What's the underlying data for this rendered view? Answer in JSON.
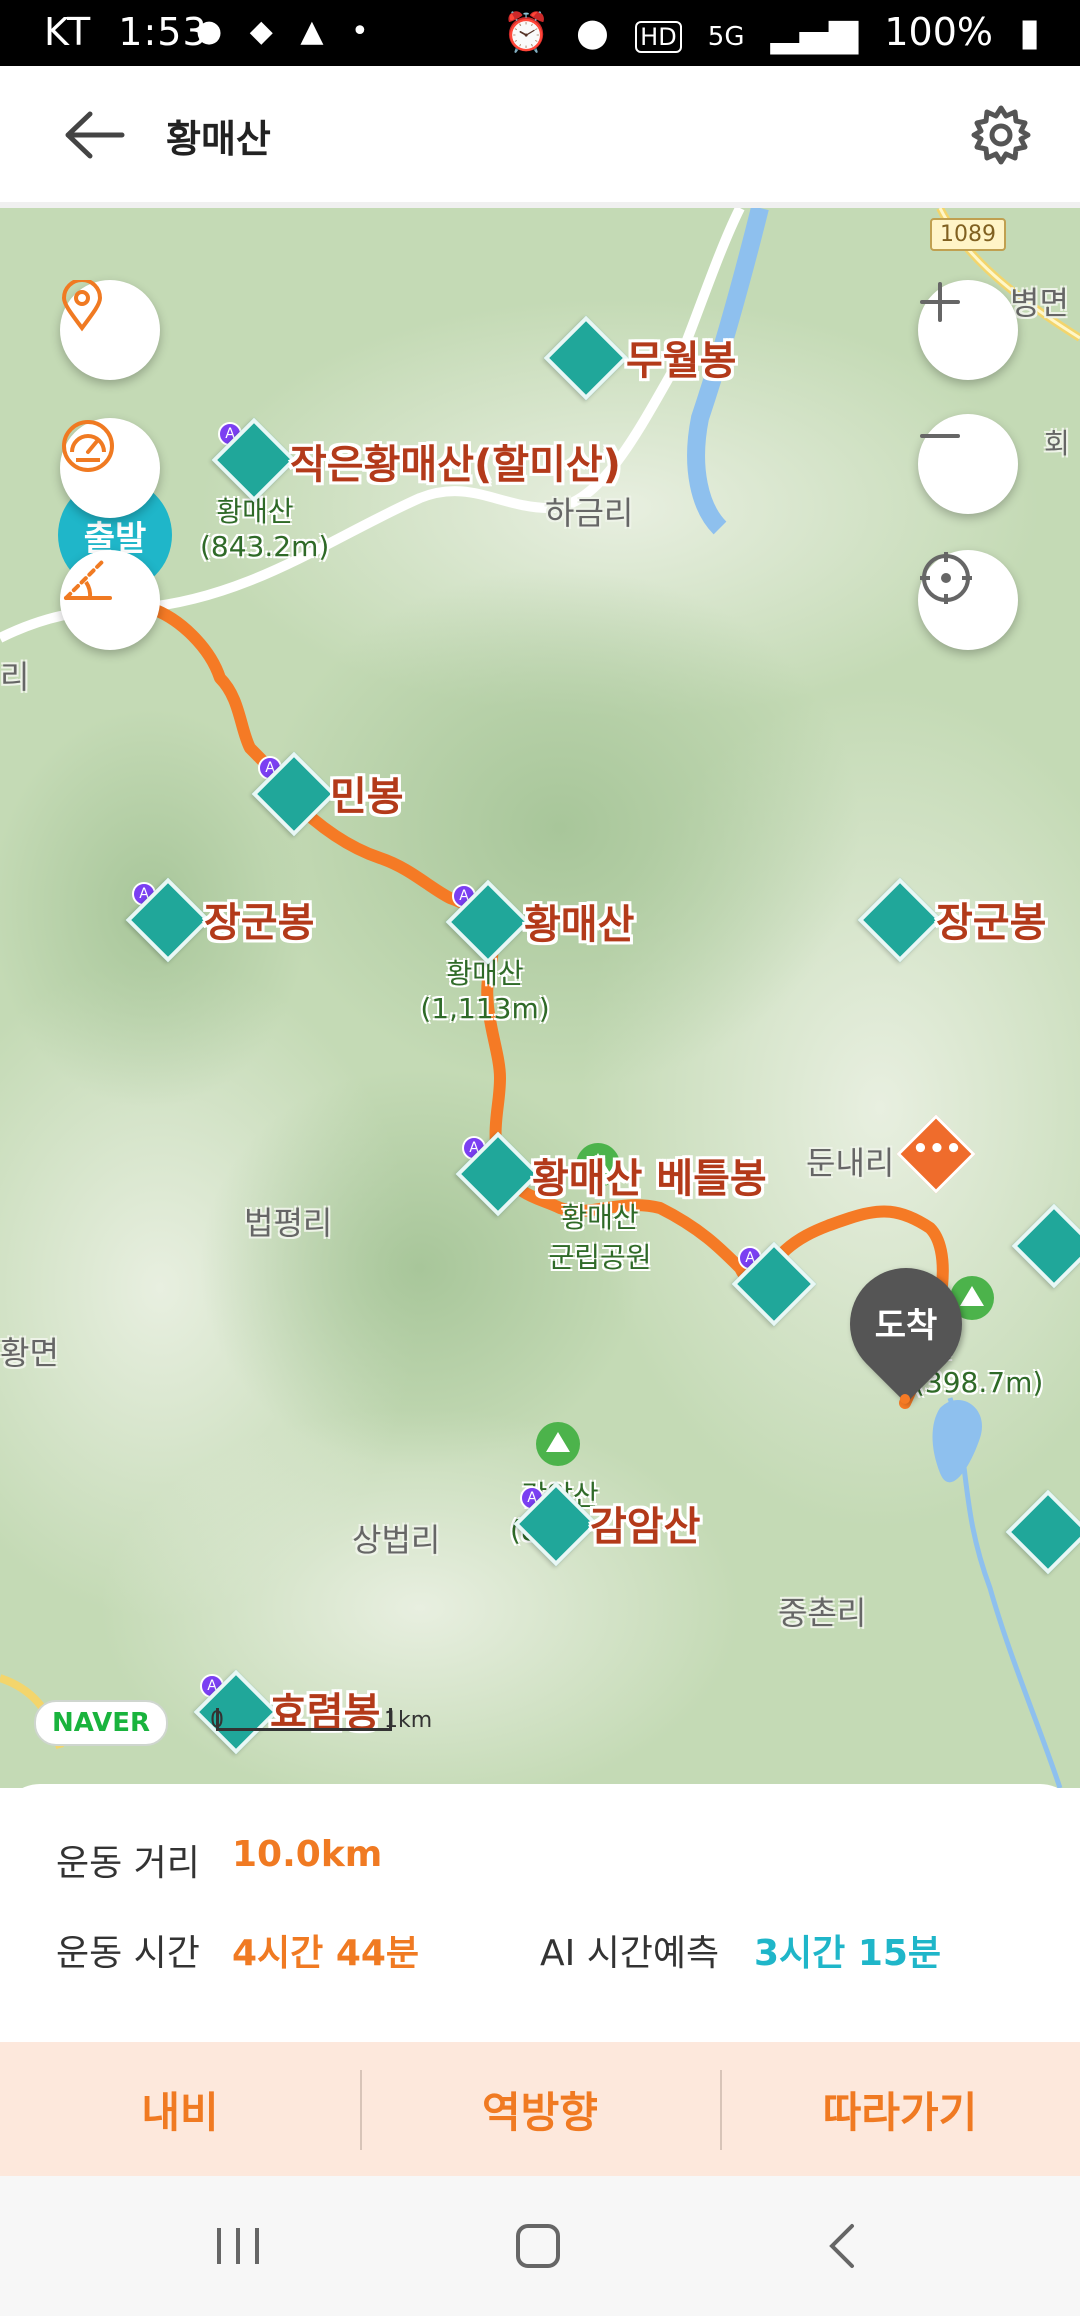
{
  "status_bar": {
    "carrier": "KT",
    "time": "1:53",
    "notification_icons": [
      "talk-icon",
      "shoe-icon",
      "app-icon",
      "dot-icon"
    ],
    "system_icons": [
      "alarm-icon",
      "location-icon",
      "hd-icon",
      "5g-icon",
      "signal-icon"
    ],
    "hd": "HD",
    "net": "5G",
    "battery": "100%"
  },
  "header": {
    "title": "황매산"
  },
  "map": {
    "peaks": [
      {
        "name": "무월봉"
      },
      {
        "name": "작은황매산(할미산)"
      },
      {
        "name": "민봉"
      },
      {
        "name": "장군봉"
      },
      {
        "name": "황매산"
      },
      {
        "name": "장군봉"
      },
      {
        "name": "황매산 베틀봉"
      },
      {
        "name": "감암산"
      },
      {
        "name": "효렴봉"
      }
    ],
    "places": [
      "하금리",
      "법평리",
      "상법리",
      "둔내리",
      "중촌리",
      "리",
      "황면",
      "병면",
      "회"
    ],
    "sub_labels": {
      "mt1_name": "황매산",
      "mt1_height": "(843.2m)",
      "mt2_name": "황매산",
      "mt2_height": "(1,113m)",
      "park_name": "황매산",
      "park_type": "군립공원",
      "mt3_name": "감암산",
      "mt3_height": "(8",
      "mt4_name": "산",
      "mt4_height": "(398.7m)"
    },
    "road_number": "1089",
    "start_marker": "출발",
    "end_marker": "도착",
    "logo": "NAVER",
    "scale": {
      "zero": "0",
      "unit": "1km"
    }
  },
  "info": {
    "distance_label": "운동 거리",
    "distance_value": "10.0km",
    "time_label": "운동 시간",
    "time_value": "4시간 44분",
    "ai_label": "AI 시간예측",
    "ai_value": "3시간 15분"
  },
  "actions": {
    "navi": "내비",
    "reverse": "역방향",
    "follow": "따라가기"
  },
  "colors": {
    "accent": "#f07a22",
    "ai": "#1fb6c9",
    "route": "#f57a25",
    "peak": "#20a79a"
  }
}
